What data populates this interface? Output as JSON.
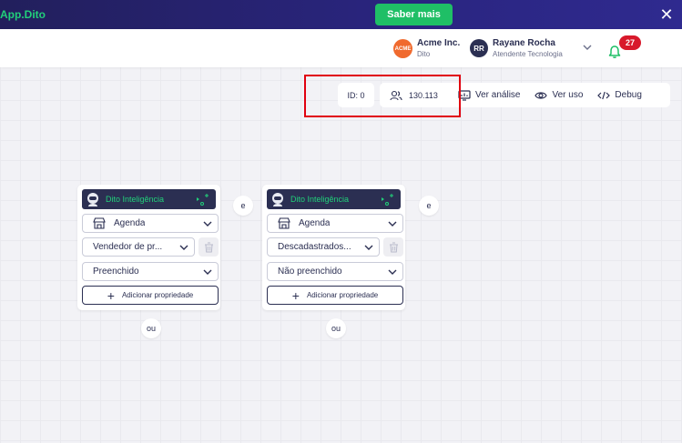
{
  "banner": {
    "brand": "App.Dito",
    "cta_label": "Saber mais",
    "close_glyph": "✕"
  },
  "header": {
    "company": {
      "logo_text": "ACME",
      "name": "Acme Inc.",
      "sub": "Dito"
    },
    "user": {
      "initials": "RR",
      "name": "Rayane Rocha",
      "role": "Atendente Tecnologia"
    },
    "notifications": {
      "count": "27",
      "icon": "bell-icon"
    }
  },
  "toolbar": {
    "id_label": "ID: 0",
    "audience_count": "130.113",
    "actions": [
      {
        "label": "Ver análise",
        "icon": "monitor-chart-icon"
      },
      {
        "label": "Ver uso",
        "icon": "eye-icon"
      },
      {
        "label": "Debug",
        "icon": "code-icon"
      }
    ]
  },
  "cards": [
    {
      "header": "Dito Inteligência",
      "event": "Agenda",
      "property": "Vendedor de pr...",
      "condition": "Preenchido",
      "add_label": "Adicionar propriedade"
    },
    {
      "header": "Dito Inteligência",
      "event": "Agenda",
      "property": "Descadastrados...",
      "condition": "Não preenchido",
      "add_label": "Adicionar propriedade"
    }
  ],
  "connectors": {
    "and": "e",
    "or": "ou"
  },
  "colors": {
    "banner": "#221f5c",
    "brand_green": "#21d07a",
    "cta_green": "#1fbf66",
    "navy": "#2b2f52",
    "badge_red": "#d8192b",
    "highlight_red": "#e0000f",
    "canvas": "#f2f2f6"
  }
}
